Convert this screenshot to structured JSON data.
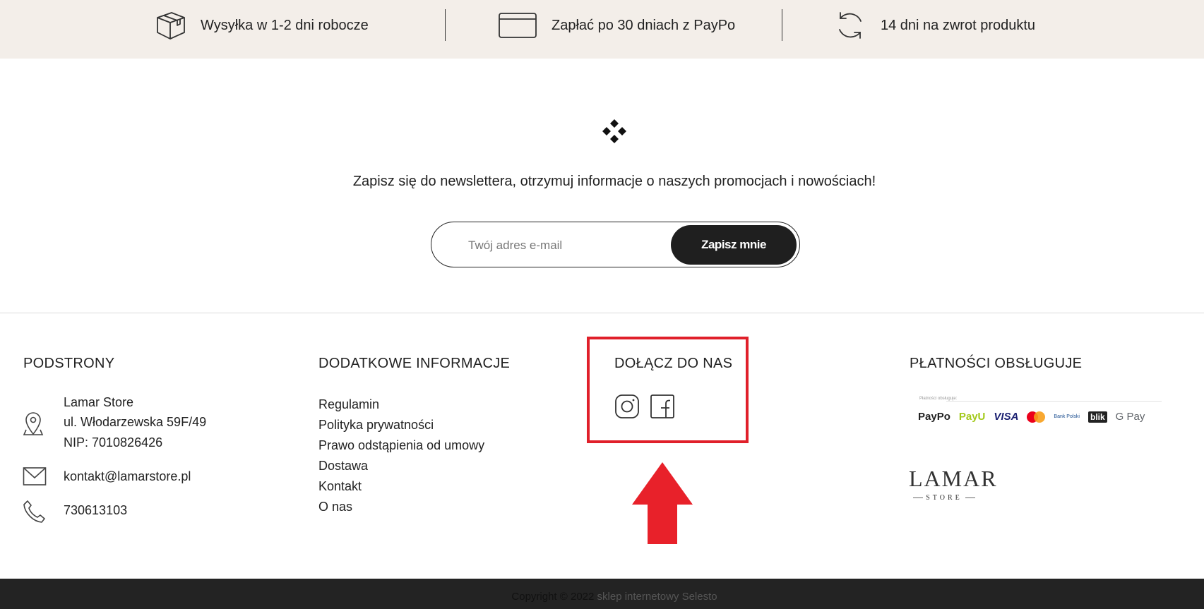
{
  "info_bar": {
    "items": [
      {
        "icon": "box-icon",
        "text": "Wysyłka w 1-2 dni robocze"
      },
      {
        "icon": "card-icon",
        "text": "Zapłać po 30 dniach z PayPo"
      },
      {
        "icon": "refresh-icon",
        "text": "14 dni na zwrot produktu"
      }
    ]
  },
  "newsletter": {
    "logo_icon": "diamonds-icon",
    "text": "Zapisz się do newslettera, otrzymuj informacje o naszych promocjach i nowościach!",
    "email_placeholder": "Twój adres e-mail",
    "button_label": "Zapisz mnie"
  },
  "footer": {
    "subpages": {
      "title": "PODSTRONY",
      "company": "Lamar Store",
      "address": "ul. Włodarzewska 59F/49",
      "nip": "NIP: 7010826426",
      "email": "kontakt@lamarstore.pl",
      "phone": "730613103"
    },
    "info": {
      "title": "DODATKOWE INFORMACJE",
      "links": [
        "Regulamin",
        "Polityka prywatności",
        "Prawo odstąpienia od umowy",
        "Dostawa",
        "Kontakt",
        "O nas"
      ]
    },
    "join": {
      "title": "DOŁĄCZ DO NAS",
      "social": [
        "instagram-icon",
        "facebook-icon"
      ]
    },
    "payments": {
      "title": "PŁATNOŚCI OBSŁUGUJE",
      "caption": "Płatności obsługuje:",
      "logos": [
        "PayPo",
        "PayU",
        "VISA",
        "mastercard",
        "Bank Polski",
        "blik",
        "G Pay"
      ],
      "brand_main": "LAMAR",
      "brand_sub": "STORE"
    }
  },
  "bottom": {
    "copyright": "Copyright © 2022",
    "link_text": "sklep internetowy Selesto"
  },
  "colors": {
    "info_bar_bg": "#f3eee9",
    "button_bg": "#1f1f1f",
    "highlight_red": "#e0202a",
    "bottom_bar_bg": "#232323"
  }
}
